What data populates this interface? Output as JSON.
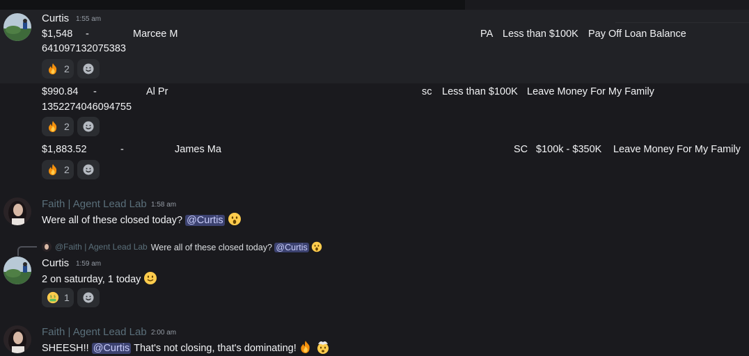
{
  "messages": [
    {
      "author": "Curtis",
      "time": "1:55 am",
      "lines": [
        {
          "amount": "$1,548",
          "dash": "-",
          "name": "Marcee M",
          "state": "PA",
          "range": "Less than $100K",
          "goal": "Pay Off Loan Balance",
          "id": "641097132075383"
        }
      ],
      "reactions": [
        {
          "emoji": "fire-emoji",
          "count": "2"
        }
      ]
    },
    {
      "lines": [
        {
          "amount": "$990.84",
          "dash": "-",
          "name": "Al Pr",
          "state": "sc",
          "range": "Less than $100K",
          "goal": "Leave Money For My Family",
          "id": "1352274046094755"
        }
      ],
      "reactions": [
        {
          "emoji": "fire-emoji",
          "count": "2"
        }
      ]
    },
    {
      "lines": [
        {
          "amount": "$1,883.52",
          "dash": "-",
          "name": "James Ma",
          "state": "SC",
          "range": "$100k - $350K",
          "goal": "Leave Money For My Family"
        }
      ],
      "reactions": [
        {
          "emoji": "fire-emoji",
          "count": "2"
        }
      ]
    },
    {
      "author": "Faith | Agent Lead Lab",
      "time": "1:58 am",
      "text": "Were all of these closed today?",
      "mention": "@Curtis"
    },
    {
      "reply": {
        "name": "@Faith | Agent Lead Lab",
        "text": "Were all of these closed today?",
        "mention": "@Curtis"
      },
      "author": "Curtis",
      "time": "1:59 am",
      "text": "2 on saturday, 1 today",
      "reactions": [
        {
          "emoji": "money-mouth-emoji",
          "count": "1"
        }
      ]
    },
    {
      "author": "Faith | Agent Lead Lab",
      "time": "2:00 am",
      "text_before": "SHEESH!!",
      "mention": "@Curtis",
      "text_after": "That's not closing, that's dominating!"
    }
  ],
  "colors": {
    "background": "#1a1a1e",
    "hover_background": "#212226",
    "mention_bg": "#3c4270",
    "mention_fg": "#c9cdfb",
    "faith_name": "#5a6f7a"
  },
  "icons": [
    "add-reaction-icon",
    "fire-emoji",
    "money-mouth-emoji",
    "astonished-emoji",
    "slightly-smiling-emoji",
    "exploding-head-emoji"
  ]
}
